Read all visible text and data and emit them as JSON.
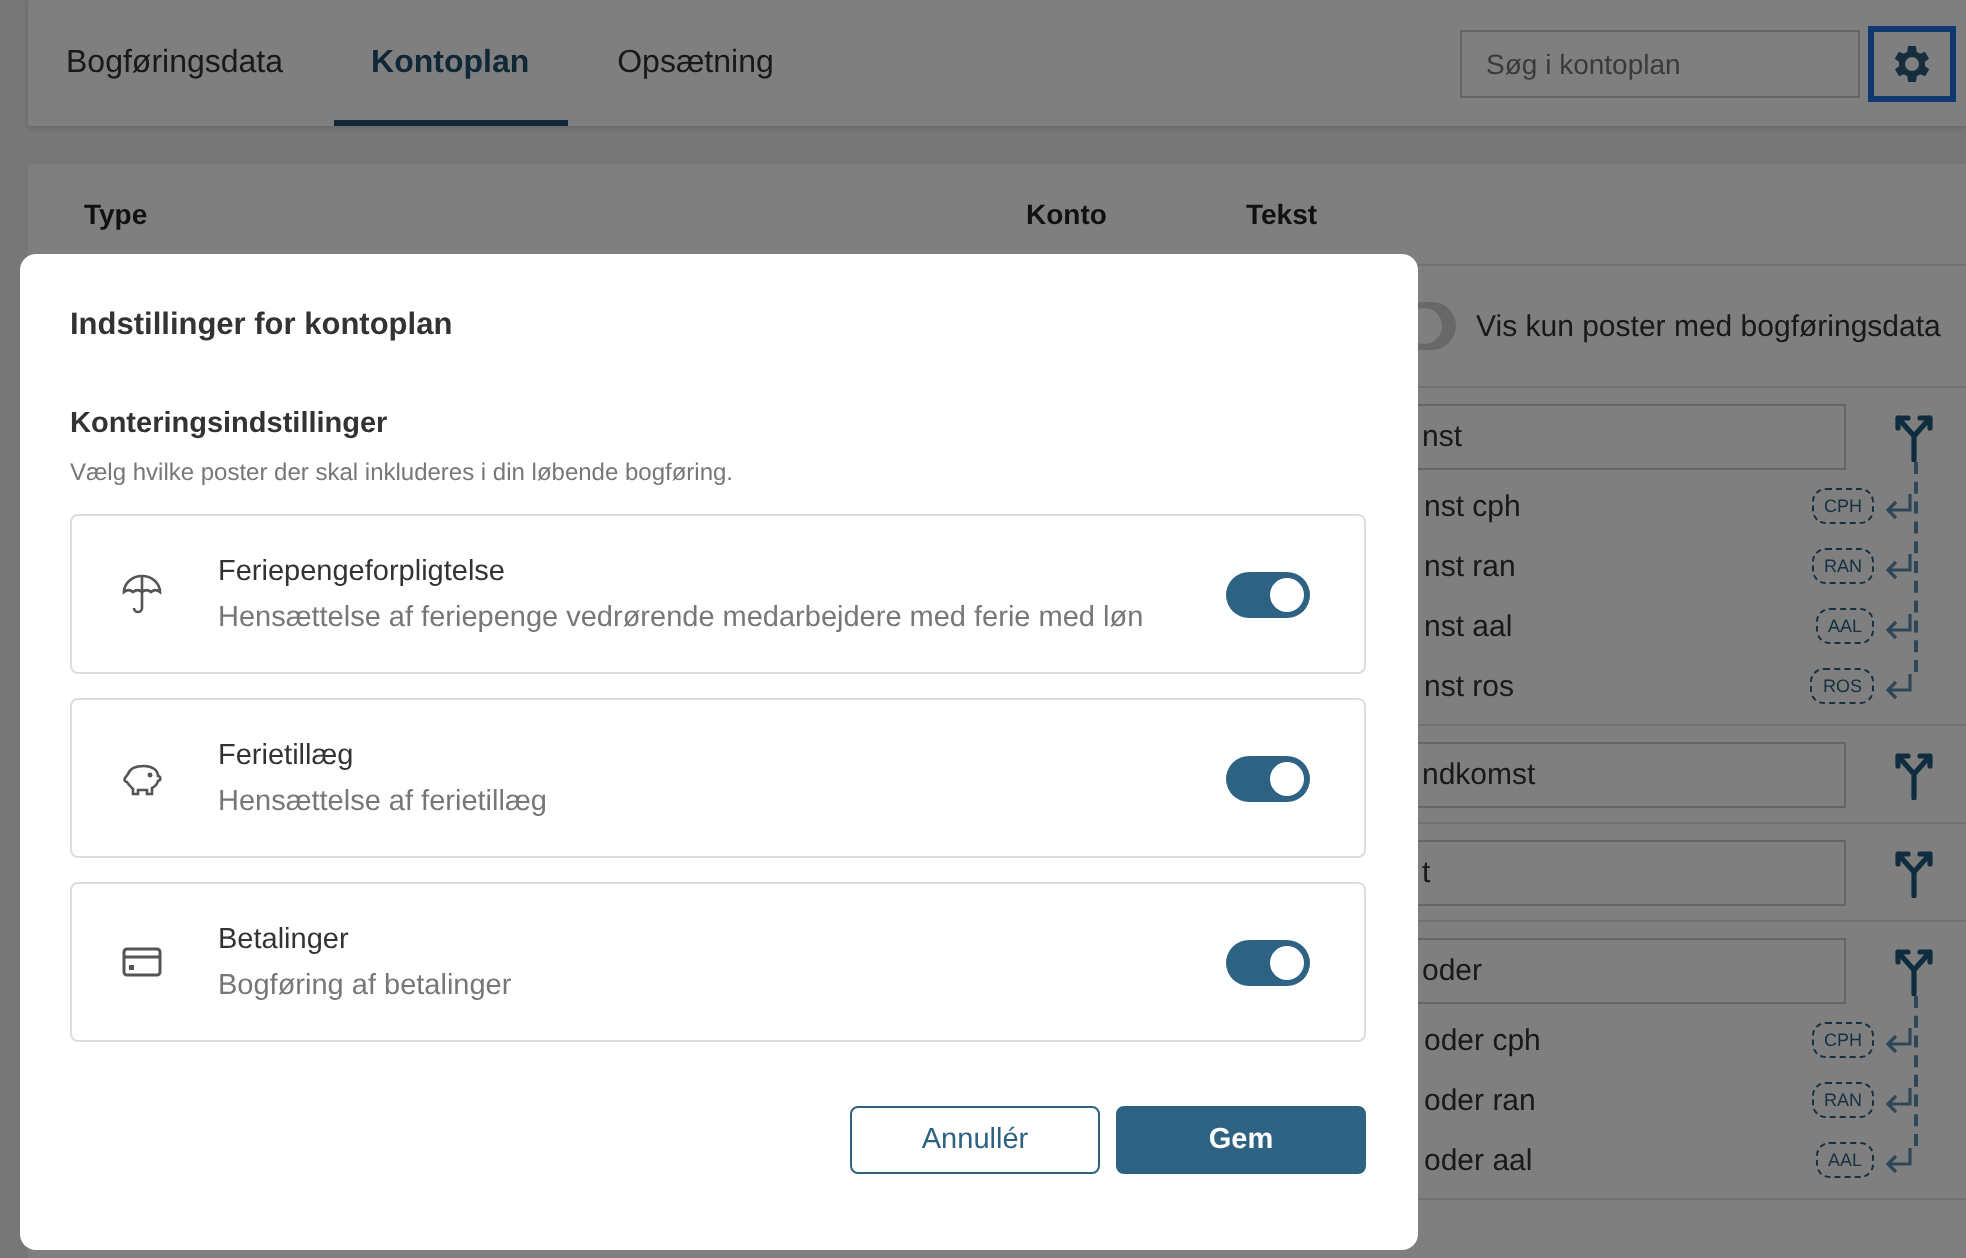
{
  "tabs": [
    {
      "label": "Bogføringsdata",
      "selected": false
    },
    {
      "label": "Kontoplan",
      "selected": true
    },
    {
      "label": "Opsætning",
      "selected": false
    }
  ],
  "search": {
    "placeholder": "Søg i kontoplan"
  },
  "table": {
    "columns": [
      "Type",
      "Konto",
      "Tekst"
    ]
  },
  "filter": {
    "label": "Vis kun poster med bogføringsdata",
    "on": false
  },
  "groups": [
    {
      "text": "nst",
      "children": [
        {
          "text": "nst cph",
          "badge": "CPH"
        },
        {
          "text": "nst ran",
          "badge": "RAN"
        },
        {
          "text": "nst aal",
          "badge": "AAL"
        },
        {
          "text": "nst ros",
          "badge": "ROS"
        }
      ]
    },
    {
      "text": "ndkomst"
    },
    {
      "text": "t"
    },
    {
      "text": "oder",
      "children": [
        {
          "text": "oder cph",
          "badge": "CPH"
        },
        {
          "text": "oder ran",
          "badge": "RAN"
        },
        {
          "text": "oder aal",
          "badge": "AAL"
        }
      ]
    }
  ],
  "modal": {
    "title": "Indstillinger for kontoplan",
    "section_title": "Konteringsindstillinger",
    "section_hint": "Vælg hvilke poster der skal inkluderes i din løbende bogføring.",
    "options": [
      {
        "kind": "umbrella",
        "title": "Feriepengeforpligtelse",
        "description": "Hensættelse af feriepenge vedrørende medarbejdere med ferie med løn",
        "on": true
      },
      {
        "kind": "piggy",
        "title": "Ferietillæg",
        "description": "Hensættelse af ferietillæg",
        "on": true
      },
      {
        "kind": "card",
        "title": "Betalinger",
        "description": "Bogføring af betalinger",
        "on": true
      }
    ],
    "buttons": [
      {
        "kind": "secondary",
        "label": "Annullér"
      },
      {
        "kind": "primary",
        "label": "Gem"
      }
    ]
  }
}
